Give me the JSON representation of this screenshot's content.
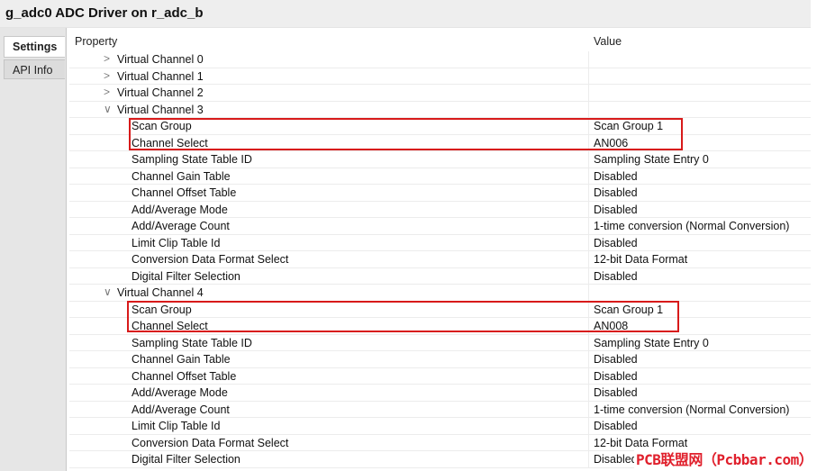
{
  "window": {
    "title": "g_adc0 ADC Driver on r_adc_b"
  },
  "tabs": [
    {
      "label": "Settings",
      "active": true
    },
    {
      "label": "API Info",
      "active": false
    }
  ],
  "table": {
    "headers": {
      "property": "Property",
      "value": "Value"
    },
    "rows": [
      {
        "kind": "group",
        "expanded": false,
        "property": "Virtual Channel 0",
        "value": ""
      },
      {
        "kind": "group",
        "expanded": false,
        "property": "Virtual Channel 1",
        "value": ""
      },
      {
        "kind": "group",
        "expanded": false,
        "property": "Virtual Channel 2",
        "value": ""
      },
      {
        "kind": "group",
        "expanded": true,
        "property": "Virtual Channel 3",
        "value": ""
      },
      {
        "kind": "leaf",
        "property": "Scan Group",
        "value": "Scan Group 1"
      },
      {
        "kind": "leaf",
        "property": "Channel Select",
        "value": "AN006"
      },
      {
        "kind": "leaf",
        "property": "Sampling State Table ID",
        "value": "Sampling State Entry 0"
      },
      {
        "kind": "leaf",
        "property": "Channel Gain Table",
        "value": "Disabled"
      },
      {
        "kind": "leaf",
        "property": "Channel Offset Table",
        "value": "Disabled"
      },
      {
        "kind": "leaf",
        "property": "Add/Average Mode",
        "value": "Disabled"
      },
      {
        "kind": "leaf",
        "property": "Add/Average Count",
        "value": "1-time conversion (Normal Conversion)"
      },
      {
        "kind": "leaf",
        "property": "Limit Clip Table Id",
        "value": "Disabled"
      },
      {
        "kind": "leaf",
        "property": "Conversion Data Format Select",
        "value": "12-bit Data Format"
      },
      {
        "kind": "leaf",
        "property": "Digital Filter Selection",
        "value": "Disabled"
      },
      {
        "kind": "group",
        "expanded": true,
        "property": "Virtual Channel 4",
        "value": ""
      },
      {
        "kind": "leaf",
        "property": "Scan Group",
        "value": "Scan Group 1"
      },
      {
        "kind": "leaf",
        "property": "Channel Select",
        "value": "AN008"
      },
      {
        "kind": "leaf",
        "property": "Sampling State Table ID",
        "value": "Sampling State Entry 0"
      },
      {
        "kind": "leaf",
        "property": "Channel Gain Table",
        "value": "Disabled"
      },
      {
        "kind": "leaf",
        "property": "Channel Offset Table",
        "value": "Disabled"
      },
      {
        "kind": "leaf",
        "property": "Add/Average Mode",
        "value": "Disabled"
      },
      {
        "kind": "leaf",
        "property": "Add/Average Count",
        "value": "1-time conversion (Normal Conversion)"
      },
      {
        "kind": "leaf",
        "property": "Limit Clip Table Id",
        "value": "Disabled"
      },
      {
        "kind": "leaf",
        "property": "Conversion Data Format Select",
        "value": "12-bit Data Format"
      },
      {
        "kind": "leaf",
        "property": "Digital Filter Selection",
        "value": "Disabled"
      }
    ]
  },
  "highlight_color": "#d81a1a",
  "watermark": "PCB联盟网（Pcbbar.com）"
}
